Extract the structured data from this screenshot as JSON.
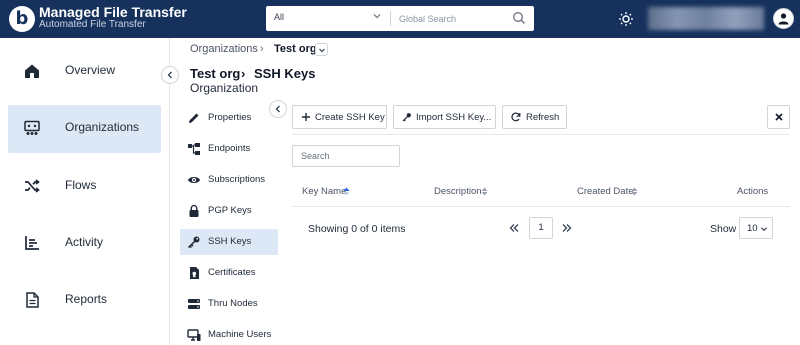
{
  "header": {
    "logo_letter": "b",
    "app_title": "Managed File Transfer",
    "app_subtitle": "Automated File Transfer",
    "search_scope": "All",
    "search_placeholder": "Global Search"
  },
  "leftnav": {
    "items": [
      {
        "label": "Overview",
        "icon": "home-icon",
        "active": false
      },
      {
        "label": "Organizations",
        "icon": "organizations-icon",
        "active": true
      },
      {
        "label": "Flows",
        "icon": "shuffle-icon",
        "active": false
      },
      {
        "label": "Activity",
        "icon": "activity-chart-icon",
        "active": false
      },
      {
        "label": "Reports",
        "icon": "report-document-icon",
        "active": false
      }
    ]
  },
  "breadcrumb": {
    "root": "Organizations",
    "separator": "›",
    "current": "Test org"
  },
  "page": {
    "title_org": "Test org",
    "title_separator": "›",
    "title_section": "SSH Keys",
    "subtitle": "Organization"
  },
  "subnav": {
    "items": [
      {
        "label": "Properties",
        "icon": "pencil-icon",
        "active": false
      },
      {
        "label": "Endpoints",
        "icon": "endpoints-icon",
        "active": false
      },
      {
        "label": "Subscriptions",
        "icon": "eye-icon",
        "active": false
      },
      {
        "label": "PGP Keys",
        "icon": "lock-icon",
        "active": false
      },
      {
        "label": "SSH Keys",
        "icon": "key-icon",
        "active": true
      },
      {
        "label": "Certificates",
        "icon": "certificate-icon",
        "active": false
      },
      {
        "label": "Thru Nodes",
        "icon": "servers-icon",
        "active": false
      },
      {
        "label": "Machine Users",
        "icon": "machine-user-icon",
        "active": false
      }
    ]
  },
  "toolbar": {
    "create_label": "Create SSH Key",
    "import_label": "Import SSH Key...",
    "refresh_label": "Refresh"
  },
  "grid": {
    "search_placeholder": "Search",
    "columns": [
      {
        "label": "Key Name",
        "sort": "ascending"
      },
      {
        "label": "Description",
        "sort": "none"
      },
      {
        "label": "Created Date",
        "sort": "none"
      },
      {
        "label": "Actions",
        "sort": null
      }
    ],
    "rows": []
  },
  "pager": {
    "summary": "Showing 0 of 0 items",
    "current_page": "1",
    "show_label": "Show",
    "page_size": "10"
  },
  "colors": {
    "header_bg": "#16325c",
    "active_nav_bg": "#dce8f5",
    "sort_active": "#2563eb"
  }
}
